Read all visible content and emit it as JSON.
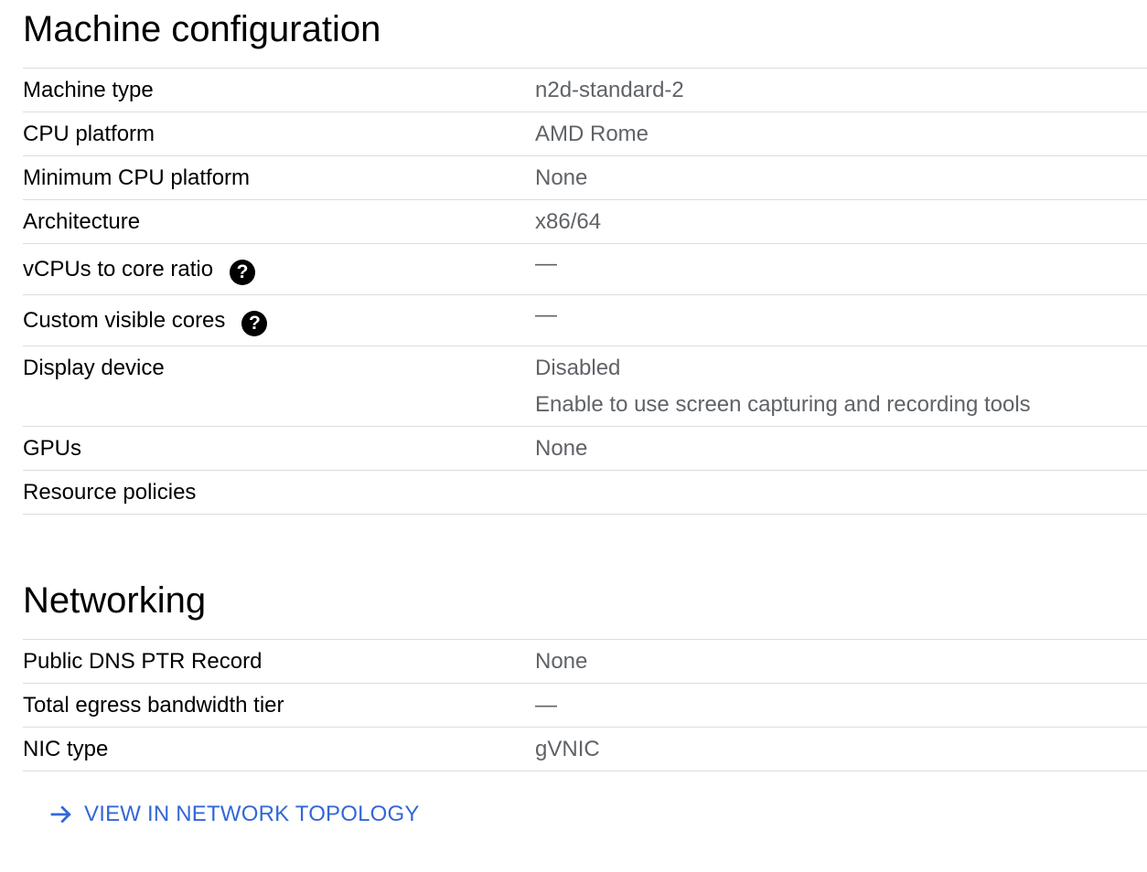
{
  "machine_configuration": {
    "title": "Machine configuration",
    "rows": [
      {
        "label": "Machine type",
        "value": "n2d-standard-2"
      },
      {
        "label": "CPU platform",
        "value": "AMD Rome"
      },
      {
        "label": "Minimum CPU platform",
        "value": "None"
      },
      {
        "label": "Architecture",
        "value": "x86/64"
      },
      {
        "label": "vCPUs to core ratio",
        "value": "—",
        "help_icon": "help-icon"
      },
      {
        "label": "Custom visible cores",
        "value": "—",
        "help_icon": "help-icon"
      },
      {
        "label": "Display device",
        "value": "Disabled",
        "sub_value": "Enable to use screen capturing and recording tools"
      },
      {
        "label": "GPUs",
        "value": "None"
      },
      {
        "label": "Resource policies",
        "value": ""
      }
    ]
  },
  "networking": {
    "title": "Networking",
    "rows": [
      {
        "label": "Public DNS PTR Record",
        "value": "None"
      },
      {
        "label": "Total egress bandwidth tier",
        "value": "—"
      },
      {
        "label": "NIC type",
        "value": "gVNIC"
      }
    ],
    "topology_link": {
      "label": "VIEW IN NETWORK TOPOLOGY",
      "icon": "arrow-right-icon"
    }
  },
  "colors": {
    "label_text": "#000000",
    "value_text": "#5f6368",
    "divider": "#dadce0",
    "link": "#3367d6"
  },
  "help_glyph": "?"
}
